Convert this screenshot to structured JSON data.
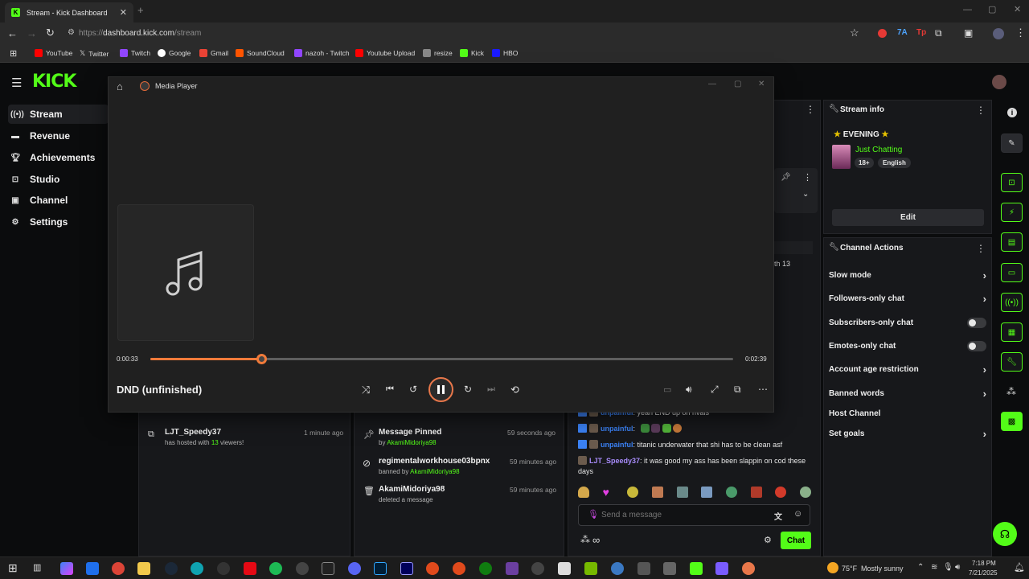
{
  "browser": {
    "tab_title": "Stream - Kick Dashboard",
    "url_prefix": "https://",
    "url_host": "dashboard.kick.com",
    "url_path": "/stream",
    "bookmarks": [
      {
        "label": "YouTube",
        "color": "#ff0000"
      },
      {
        "label": "Twitter",
        "color": "#000000"
      },
      {
        "label": "Twitch",
        "color": "#9146ff"
      },
      {
        "label": "Google",
        "color": "#4285f4"
      },
      {
        "label": "Gmail",
        "color": "#ea4335"
      },
      {
        "label": "SoundCloud",
        "color": "#ff5500"
      },
      {
        "label": "nazoh - Twitch",
        "color": "#9146ff"
      },
      {
        "label": "Youtube Upload",
        "color": "#ff0000"
      },
      {
        "label": "resize",
        "color": "#888888"
      },
      {
        "label": "Kick",
        "color": "#53fc18"
      },
      {
        "label": "HBO",
        "color": "#1a1aff"
      }
    ]
  },
  "sidebar": {
    "items": [
      {
        "label": "Stream",
        "icon": "broadcast-icon",
        "active": true
      },
      {
        "label": "Revenue",
        "icon": "revenue-icon"
      },
      {
        "label": "Achievements",
        "icon": "trophy-icon"
      },
      {
        "label": "Studio",
        "icon": "studio-icon"
      },
      {
        "label": "Channel",
        "icon": "channel-icon"
      },
      {
        "label": "Settings",
        "icon": "gear-icon"
      }
    ]
  },
  "stream_info": {
    "title": "Stream info",
    "stream_title": "EVENING",
    "category": "Just Chatting",
    "tags": [
      "18+",
      "English"
    ],
    "edit_label": "Edit"
  },
  "channel_actions": {
    "title": "Channel Actions",
    "items": [
      {
        "label": "Slow mode",
        "control": "chevron"
      },
      {
        "label": "Followers-only chat",
        "control": "chevron"
      },
      {
        "label": "Subscribers-only chat",
        "control": "toggle"
      },
      {
        "label": "Emotes-only chat",
        "control": "toggle"
      },
      {
        "label": "Account age restriction",
        "control": "chevron"
      },
      {
        "label": "Banned words",
        "control": "chevron"
      },
      {
        "label": "Host Channel",
        "control": "none"
      },
      {
        "label": "Set goals",
        "control": "chevron"
      }
    ]
  },
  "partial_text": {
    "th13": "th 13"
  },
  "activity_feed": {
    "user": "LJT_Speedy37",
    "pre": "has hosted with ",
    "count": "13",
    "post": " viewers!",
    "time": "1 minute ago"
  },
  "mod_actions": [
    {
      "title": "Message Pinned",
      "by_prefix": "by ",
      "by": "AkamiMidoriya98",
      "time": "59 seconds ago",
      "icon": "pin-icon"
    },
    {
      "title": "regimentalworkhouse03bpnx",
      "by_prefix": "banned by ",
      "by": "AkamiMidoriya98",
      "time": "59 minutes ago",
      "icon": "ban-icon"
    },
    {
      "title": "AkamiMidoriya98",
      "by_prefix": "",
      "by": "deleted a message",
      "time": "59 minutes ago",
      "icon": "trash-icon"
    }
  ],
  "chat": {
    "lines": [
      {
        "user": "unpainful",
        "text": ": yeah END up on rivals",
        "user_color": "#3b82f6"
      },
      {
        "user": "unpainful",
        "text": ":",
        "user_color": "#3b82f6"
      },
      {
        "user": "unpainful",
        "text": ": titanic underwater that shi has to be clean asf",
        "user_color": "#3b82f6"
      },
      {
        "user": "LJT_Speedy37",
        "text": ": it was good my ass has been slappin on cod these days",
        "user_color": "#a78bfa"
      }
    ],
    "placeholder": "Send a message",
    "chat_button": "Chat"
  },
  "media_player": {
    "app_title": "Media Player",
    "track_title": "DND (unfinished)",
    "elapsed": "0:00:33",
    "duration": "0:02:39",
    "progress": 0.19,
    "accent": "#f07a3a"
  },
  "taskbar": {
    "weather_temp": "75°F",
    "weather_text": "Mostly sunny",
    "time": "7:18 PM",
    "date": "7/21/2025"
  }
}
